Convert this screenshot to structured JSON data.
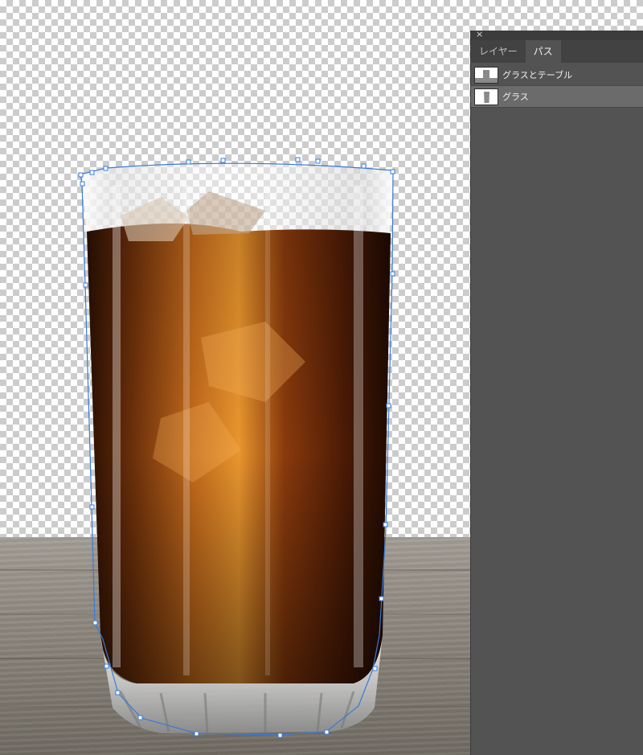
{
  "window": {
    "close_glyph": "×"
  },
  "panel": {
    "tabs": [
      {
        "label": "レイヤー",
        "active": false
      },
      {
        "label": "パス",
        "active": true
      }
    ],
    "paths": [
      {
        "label": "グラスとテーブル",
        "selected": false,
        "thumb_icon": "glass-and-table-thumb-icon"
      },
      {
        "label": "グラス",
        "selected": true,
        "thumb_icon": "glass-thumb-icon"
      }
    ]
  },
  "colors": {
    "panel_bg": "#535353",
    "panel_tab_bar": "#424242",
    "selected_row": "#6b6b6b",
    "path_outline": "#3a7bd5",
    "cola": "#5a2608"
  }
}
